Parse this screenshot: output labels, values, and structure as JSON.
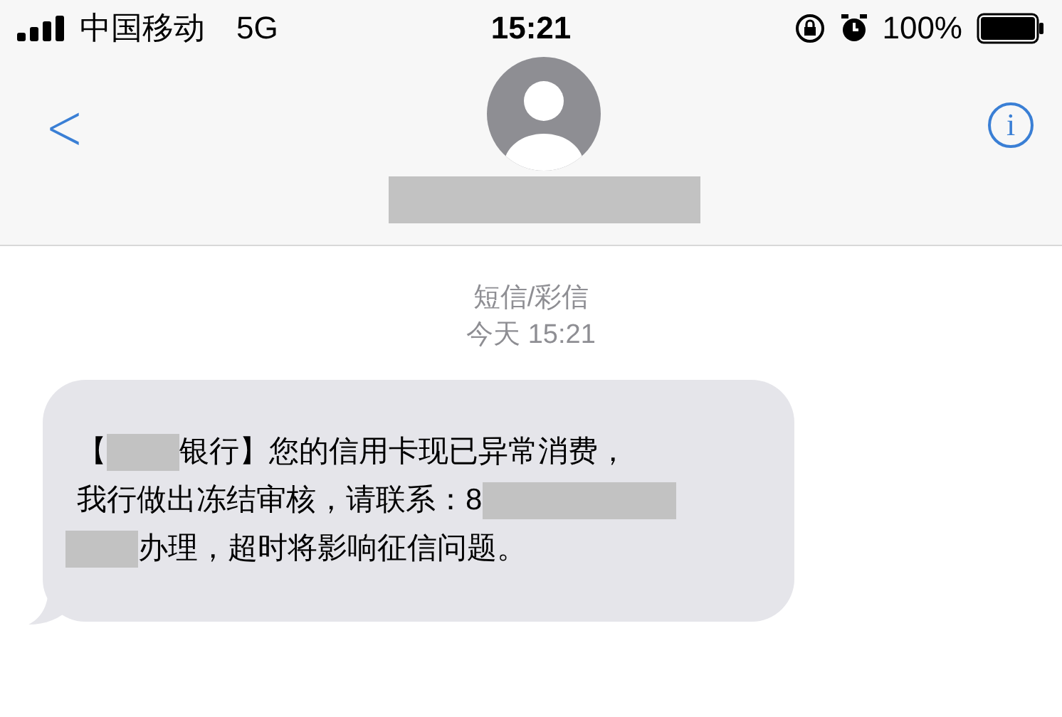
{
  "status_bar": {
    "carrier": "中国移动",
    "network": "5G",
    "time": "15:21",
    "battery": "100%"
  },
  "header": {
    "back": "<",
    "info": "i",
    "contact": {
      "kind": "redacted"
    }
  },
  "thread": {
    "service": "短信/彩信",
    "timestamp": "今天 15:21"
  },
  "message": {
    "lines": [
      [
        {
          "kind": "text",
          "text": "【"
        },
        {
          "kind": "redacted"
        },
        {
          "kind": "text",
          "text": "银行】您的信用卡现已异常消费，"
        }
      ],
      [
        {
          "kind": "text",
          "text": "我行做出冻结审核，请联系：8"
        },
        {
          "kind": "redacted"
        }
      ],
      [
        {
          "kind": "redacted"
        },
        {
          "kind": "text",
          "text": "办理，超时将影响征信问题。"
        }
      ]
    ]
  }
}
